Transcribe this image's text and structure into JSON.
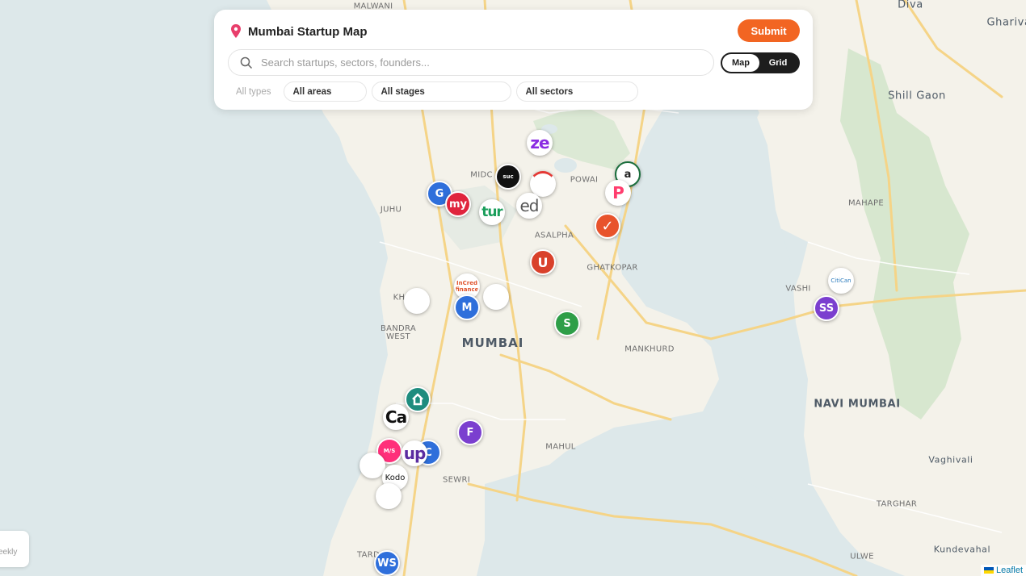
{
  "header": {
    "title": "Mumbai Startup Map",
    "submit_label": "Submit",
    "pin_color": "#e83e6b"
  },
  "search": {
    "placeholder": "Search startups, sectors, founders..."
  },
  "view_toggle": {
    "map_label": "Map",
    "grid_label": "Grid",
    "active": "Map"
  },
  "filters": [
    {
      "label": "All types"
    },
    {
      "label": "All areas"
    },
    {
      "label": "All stages"
    },
    {
      "label": "All sectors"
    }
  ],
  "weekly_label": "eekly",
  "attribution": "Leaflet",
  "places": [
    "MALWANI",
    "Diva",
    "Ghariva",
    "Shill Gaon",
    "MIDC",
    "POWAI",
    "JUHU",
    "MAHAPE",
    "ASALPHA",
    "GHATKOPAR",
    "VASHI",
    "KH",
    "BANDRA WEST",
    "MUMBAI",
    "MANKHURD",
    "NAVI MUMBAI",
    "MAHUL",
    "Vaghivali",
    "SEWRI",
    "TARGHAR",
    "TARD",
    "ULWE",
    "Kundevahal"
  ],
  "markers": [
    {
      "label": "ze",
      "color": "#ffffff",
      "text_color": "#8a2be2"
    },
    {
      "label": "suc",
      "color": "#111111",
      "text_color": "#ffffff"
    },
    {
      "label": "",
      "color": "#ffffff",
      "text_color": "#e53935"
    },
    {
      "label": "a",
      "color": "#ffffff",
      "text_color": "#222222"
    },
    {
      "label": "G",
      "color": "#2f6fdb",
      "text_color": "#ffffff"
    },
    {
      "label": "my",
      "color": "#e0243d",
      "text_color": "#ffffff"
    },
    {
      "label": "tur",
      "color": "#ffffff",
      "text_color": "#1a9e5b"
    },
    {
      "label": "ed",
      "color": "#ffffff",
      "text_color": "#555555"
    },
    {
      "label": "P",
      "color": "#ffffff",
      "text_color": "#ff3d6e"
    },
    {
      "label": "✓",
      "color": "#e8532c",
      "text_color": "#ffffff"
    },
    {
      "label": "U",
      "color": "#d9412b",
      "text_color": "#ffffff"
    },
    {
      "label": "InCred finance",
      "color": "#ffffff",
      "text_color": "#e0532c"
    },
    {
      "label": "",
      "color": "#ffffff",
      "text_color": "#ffffff"
    },
    {
      "label": "",
      "color": "#ffffff",
      "text_color": "#ffffff"
    },
    {
      "label": "M",
      "color": "#2f6fdb",
      "text_color": "#ffffff"
    },
    {
      "label": "S",
      "color": "#2e9e48",
      "text_color": "#ffffff"
    },
    {
      "label": "CitiCan",
      "color": "#ffffff",
      "text_color": "#2a7bbd"
    },
    {
      "label": "SS",
      "color": "#7b3fcf",
      "text_color": "#ffffff"
    },
    {
      "label": "",
      "color": "#1e8c7e",
      "text_color": "#ffffff"
    },
    {
      "label": "Ca",
      "color": "#ffffff",
      "text_color": "#111111"
    },
    {
      "label": "F",
      "color": "#7b3fcf",
      "text_color": "#ffffff"
    },
    {
      "label": "M/S",
      "color": "#ff2f7a",
      "text_color": "#ffffff"
    },
    {
      "label": "C",
      "color": "#2f6fdb",
      "text_color": "#ffffff"
    },
    {
      "label": "up",
      "color": "#ffffff",
      "text_color": "#5a2ca0"
    },
    {
      "label": "",
      "color": "#ffffff",
      "text_color": "#ffffff"
    },
    {
      "label": "Kodo",
      "color": "#ffffff",
      "text_color": "#111111"
    },
    {
      "label": "",
      "color": "#ffffff",
      "text_color": "#ffffff"
    },
    {
      "label": "WS",
      "color": "#2f6fdb",
      "text_color": "#ffffff"
    }
  ],
  "colors": {
    "accent": "#f26522",
    "water": "#dde8ea",
    "land": "#f6f4ee",
    "road": "#f7d98b"
  }
}
